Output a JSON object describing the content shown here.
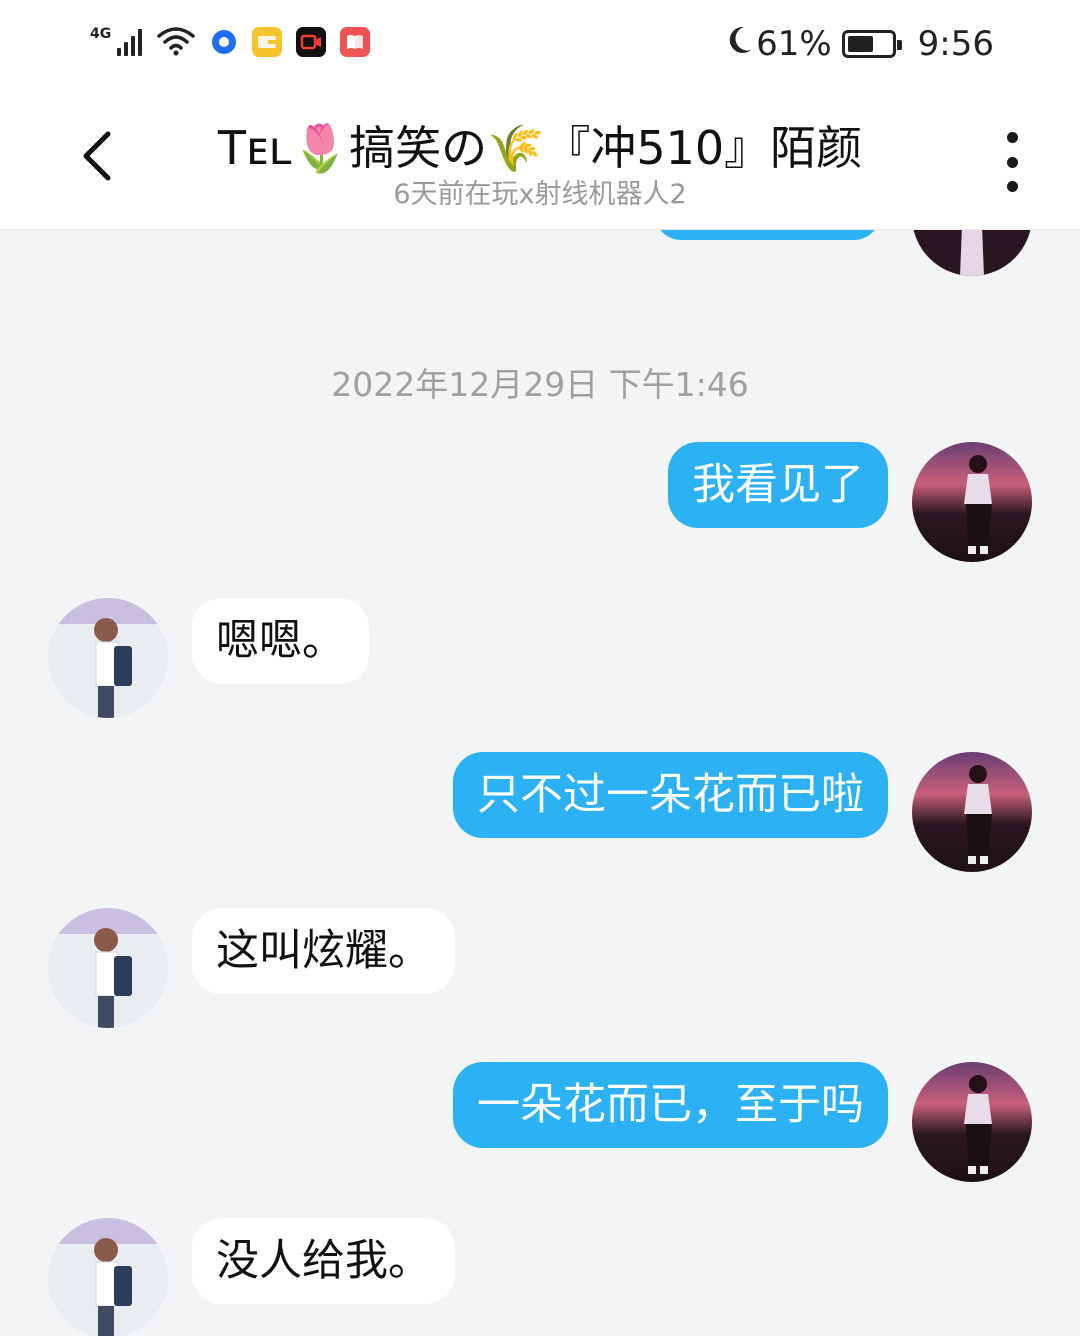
{
  "status_bar": {
    "network": "4G",
    "battery_percent": "61%",
    "battery_level": 0.61,
    "time": "9:56",
    "notification_icons": [
      "blue-circle-app-icon",
      "yellow-wallet-app-icon",
      "black-video-app-icon",
      "red-book-app-icon"
    ]
  },
  "header": {
    "title": "Tᴇʟ🌷搞笑の🌾『冲510』陌颜",
    "subtitle": "6天前在玩x射线机器人2"
  },
  "chat": {
    "timestamp": "2022年12月29日 下午1:46",
    "messages": [
      {
        "sender": "me",
        "text": "我看见了"
      },
      {
        "sender": "them",
        "text": "嗯嗯。"
      },
      {
        "sender": "me",
        "text": "只不过一朵花而已啦"
      },
      {
        "sender": "them",
        "text": "这叫炫耀。"
      },
      {
        "sender": "me",
        "text": "一朵花而已，至于吗"
      },
      {
        "sender": "them",
        "text": "没人给我。"
      }
    ]
  },
  "colors": {
    "my_bubble": "#2cb1f5",
    "their_bubble": "#ffffff",
    "chat_background": "#f3f4f6"
  }
}
